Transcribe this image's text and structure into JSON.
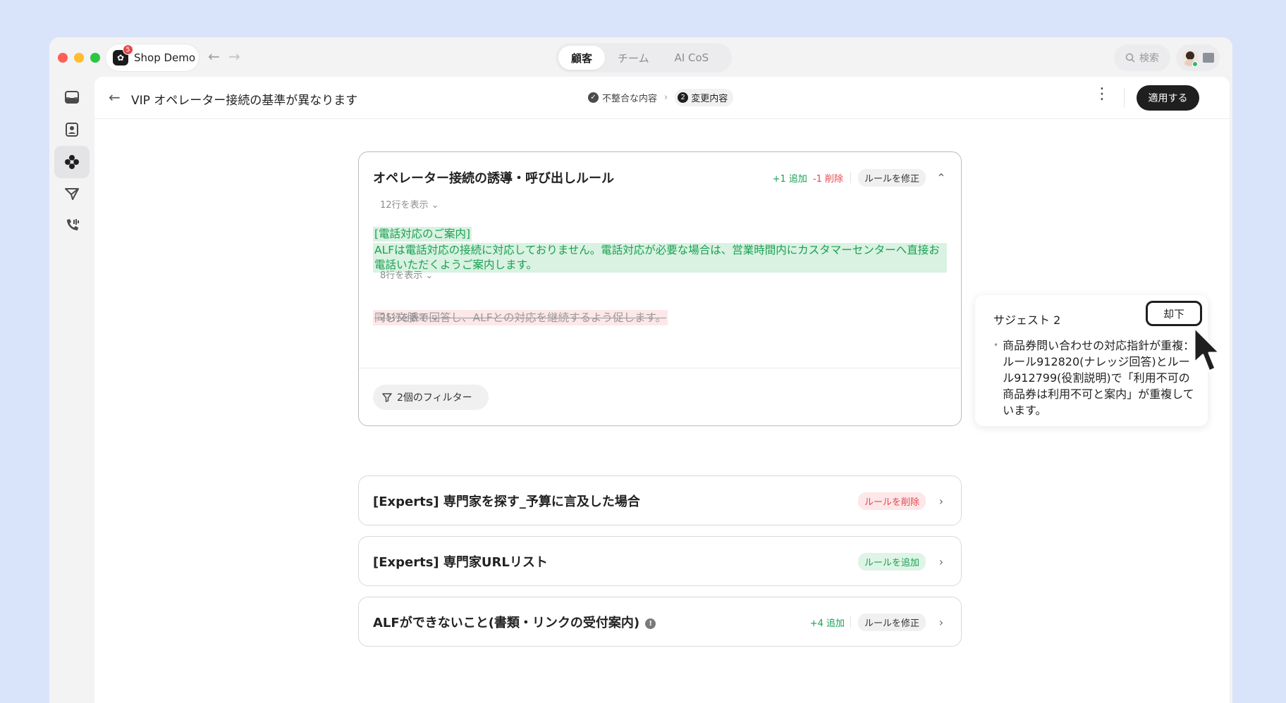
{
  "titlebar": {
    "app_name": "Shop Demo",
    "app_badge": "5",
    "tabs": [
      "顧客",
      "チーム",
      "AI CoS"
    ],
    "active_tab": 0,
    "search_placeholder": "検索"
  },
  "sidebar": {
    "items": [
      "inbox-icon",
      "contacts-icon",
      "ai-agent-icon",
      "send-icon",
      "phone-icon"
    ],
    "active_index": 2
  },
  "header": {
    "title": "VIP オペレーター接続の基準が異なります",
    "step1_label": "不整合な内容",
    "step2_number": "2",
    "step2_label": "変更内容",
    "apply_label": "適用する"
  },
  "expanded_card": {
    "title": "オペレーター接続の誘導・呼び出しルール",
    "added_count": "+1 追加",
    "deleted_count": "-1 削除",
    "tag": "ルールを修正",
    "show_lines_1": "12行を表示",
    "added_heading": "[電話対応のご案内]",
    "added_text": "ALFは電話対応の接続に対応しておりません。電話対応が必要な場合は、営業時間内にカスタマーセンターへ直接お電話いただくようご案内します。",
    "show_lines_2": "8行を表示",
    "deleted_text": "同じ文脈で回答し、ALFとの対応を継続するよう促します。",
    "show_lines_3": "25行を表示",
    "filter_label": "2個のフィルター"
  },
  "rows": [
    {
      "title": "[Experts] 専門家を探す_予算に言及した場合",
      "tag": "ルールを削除",
      "tag_kind": "red",
      "count": ""
    },
    {
      "title": "[Experts] 専門家URLリスト",
      "tag": "ルールを追加",
      "tag_kind": "green",
      "count": ""
    },
    {
      "title": "ALFができないこと(書類・リンクの受付案内)",
      "tag": "ルールを修正",
      "tag_kind": "gray",
      "count": "+4 追加"
    }
  ],
  "suggestion": {
    "title": "サジェスト 2",
    "reject_label": "却下",
    "body": "商品券問い合わせの対応指針が重複：ルール912820(ナレッジ回答)とルール912799(役割説明)で「利用不可の商品券は利用不可と案内」が重複しています。"
  },
  "colors": {
    "added_green": "#1aa052",
    "added_bg": "#d9f2e1",
    "deleted_red": "#e5484d",
    "deleted_bg": "#fde7e8",
    "primary_dark": "#1f1f1f"
  }
}
